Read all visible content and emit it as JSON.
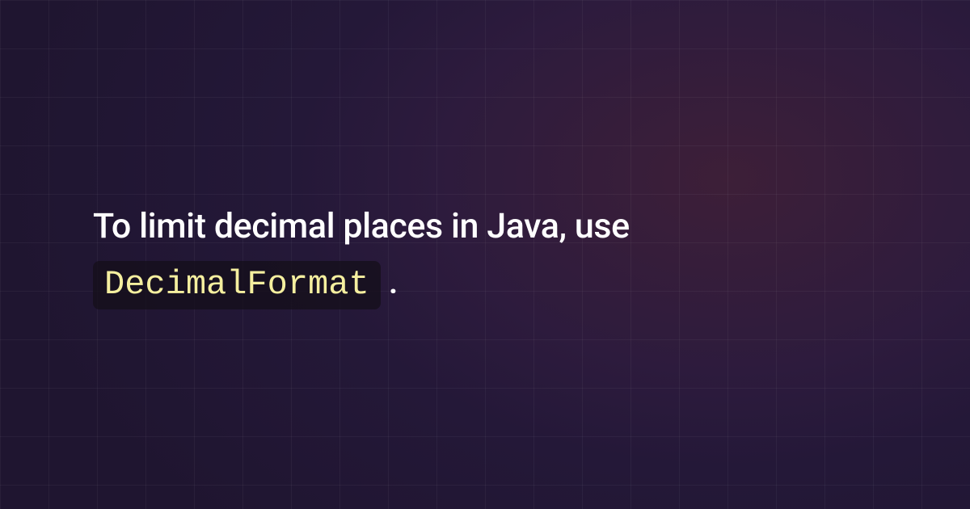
{
  "content": {
    "text_before": "To limit decimal places in Java, use",
    "code_text": "DecimalFormat",
    "text_after": "."
  }
}
